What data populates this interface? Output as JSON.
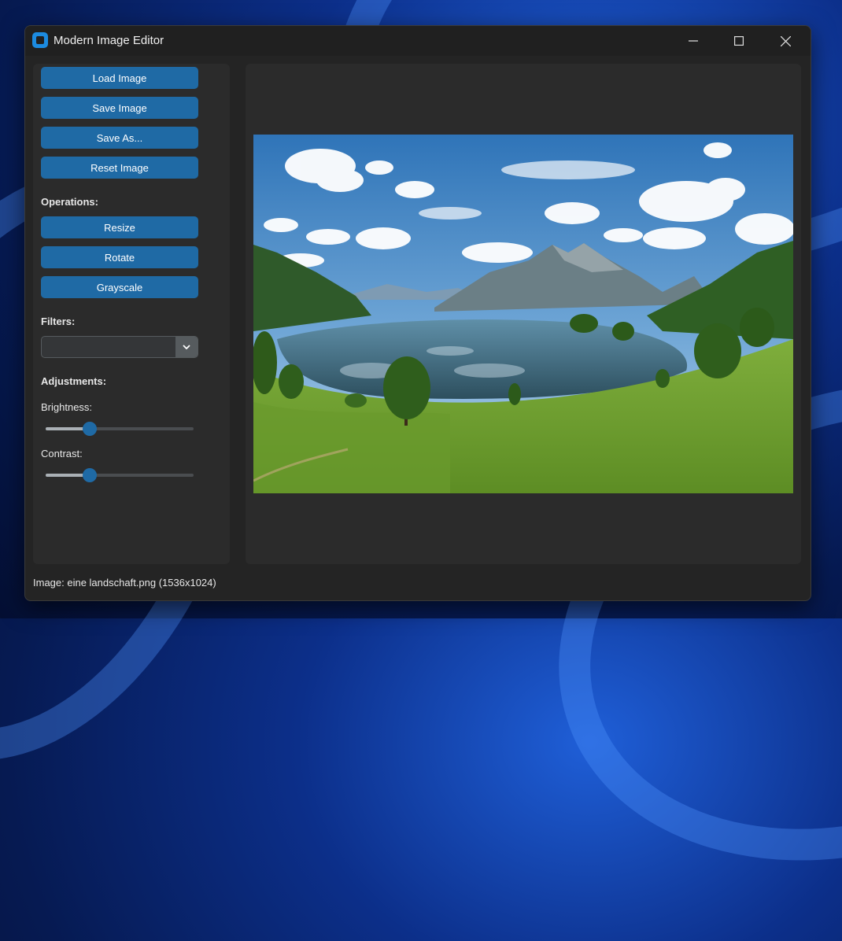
{
  "window": {
    "title": "Modern Image Editor"
  },
  "file_buttons": {
    "load": "Load Image",
    "save": "Save Image",
    "save_as": "Save As...",
    "reset": "Reset Image"
  },
  "operations": {
    "label": "Operations:",
    "resize": "Resize",
    "rotate": "Rotate",
    "grayscale": "Grayscale"
  },
  "filters": {
    "label": "Filters:",
    "selected": ""
  },
  "adjustments": {
    "label": "Adjustments:",
    "brightness": {
      "label": "Brightness:",
      "level": 0.3
    },
    "contrast": {
      "label": "Contrast:",
      "level": 0.3
    }
  },
  "status": {
    "text": "Image: eine landschaft.png (1536x1024)"
  },
  "colors": {
    "accent": "#1f6aa5",
    "background": "#242424",
    "panel": "#2b2b2b"
  },
  "icons": [
    "app-icon",
    "minimize-icon",
    "maximize-icon",
    "close-icon",
    "chevron-down-icon"
  ]
}
